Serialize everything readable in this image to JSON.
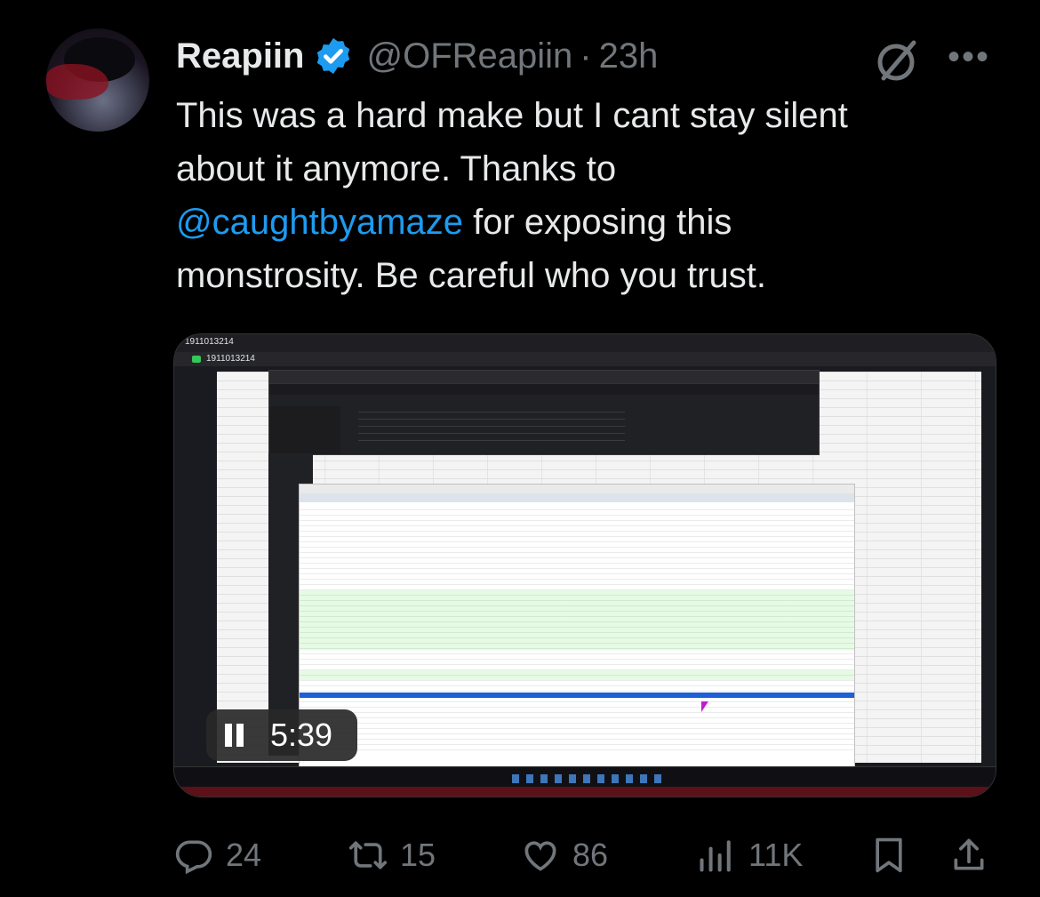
{
  "author": {
    "name": "Reapiin",
    "handle": "@OFReapiin",
    "separator": "·",
    "time": "23h"
  },
  "tweet": {
    "line1": "This was a hard make but I cant stay silent",
    "line2": "about it anymore. Thanks to",
    "mention": "@caughtbyamaze",
    "line3_rest": " for exposing this",
    "line4": "monstrosity. Be careful who you trust."
  },
  "video": {
    "timer": "5:39",
    "window_title": "1911013214",
    "tab_title": "1911013214"
  },
  "actions": {
    "replies": "24",
    "reposts": "15",
    "likes": "86",
    "views": "11K"
  },
  "icons": {
    "verified": "verified-badge-icon",
    "grok": "grok-icon",
    "more": "more-icon",
    "reply": "reply-icon",
    "repost": "repost-icon",
    "like": "like-icon",
    "views": "views-icon",
    "bookmark": "bookmark-icon",
    "share": "share-icon",
    "pause": "pause-icon"
  },
  "colors": {
    "background": "#000000",
    "text": "#e7e9ea",
    "muted": "#71767b",
    "link": "#1d9bf0",
    "verified": "#1d9bf0"
  }
}
